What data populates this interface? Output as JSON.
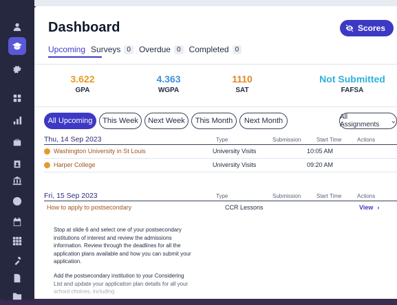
{
  "page": {
    "title": "Dashboard",
    "scores_label": "Scores"
  },
  "tabs": [
    {
      "label": "Upcoming",
      "count": ""
    },
    {
      "label": "Surveys",
      "count": "0"
    },
    {
      "label": "Overdue",
      "count": "0"
    },
    {
      "label": "Completed",
      "count": "0"
    }
  ],
  "stats": [
    {
      "value": "3.622",
      "label": "GPA",
      "color": "#e59b1f"
    },
    {
      "value": "4.363",
      "label": "WGPA",
      "color": "#3f8fdc"
    },
    {
      "value": "1110",
      "label": "SAT",
      "color": "#e2861f"
    },
    {
      "value": "Not Submitted",
      "label": "FAFSA",
      "color": "#2fb0dc"
    }
  ],
  "filters": [
    "All Upcoming",
    "This Week",
    "Next Week",
    "This Month",
    "Next Month"
  ],
  "assignments_select": "All Assignments",
  "columns": {
    "type": "Type",
    "submission": "Submission",
    "start": "Start Time",
    "actions": "Actions"
  },
  "days": [
    {
      "date": "Thu, 14 Sep 2023",
      "rows": [
        {
          "name": "Washington University in St Louis",
          "type": "University Visits",
          "submission": "",
          "start": "10:05 AM",
          "action": ""
        },
        {
          "name": "Harper College",
          "type": "University Visits",
          "submission": "",
          "start": "09:20 AM",
          "action": ""
        }
      ]
    },
    {
      "date": "Fri, 15 Sep 2023",
      "rows": [
        {
          "name": "How to apply to postsecondary",
          "type": "CCR Lessons",
          "submission": "",
          "start": "",
          "action": "View"
        }
      ]
    }
  ],
  "lesson_text": {
    "p1": "Stop at slide 6 and select one of your postsecondary institutions of interest and review the admissions information. Review through the deadlines for all the application plans available and how you can submit your application.",
    "p2": "Add the postsecondary institution to your Considering List and update your application plan details for all your school choices, including"
  },
  "colors": {
    "accent": "#3d39c4",
    "sidebar": "#25283f",
    "link": "#a0531c"
  }
}
